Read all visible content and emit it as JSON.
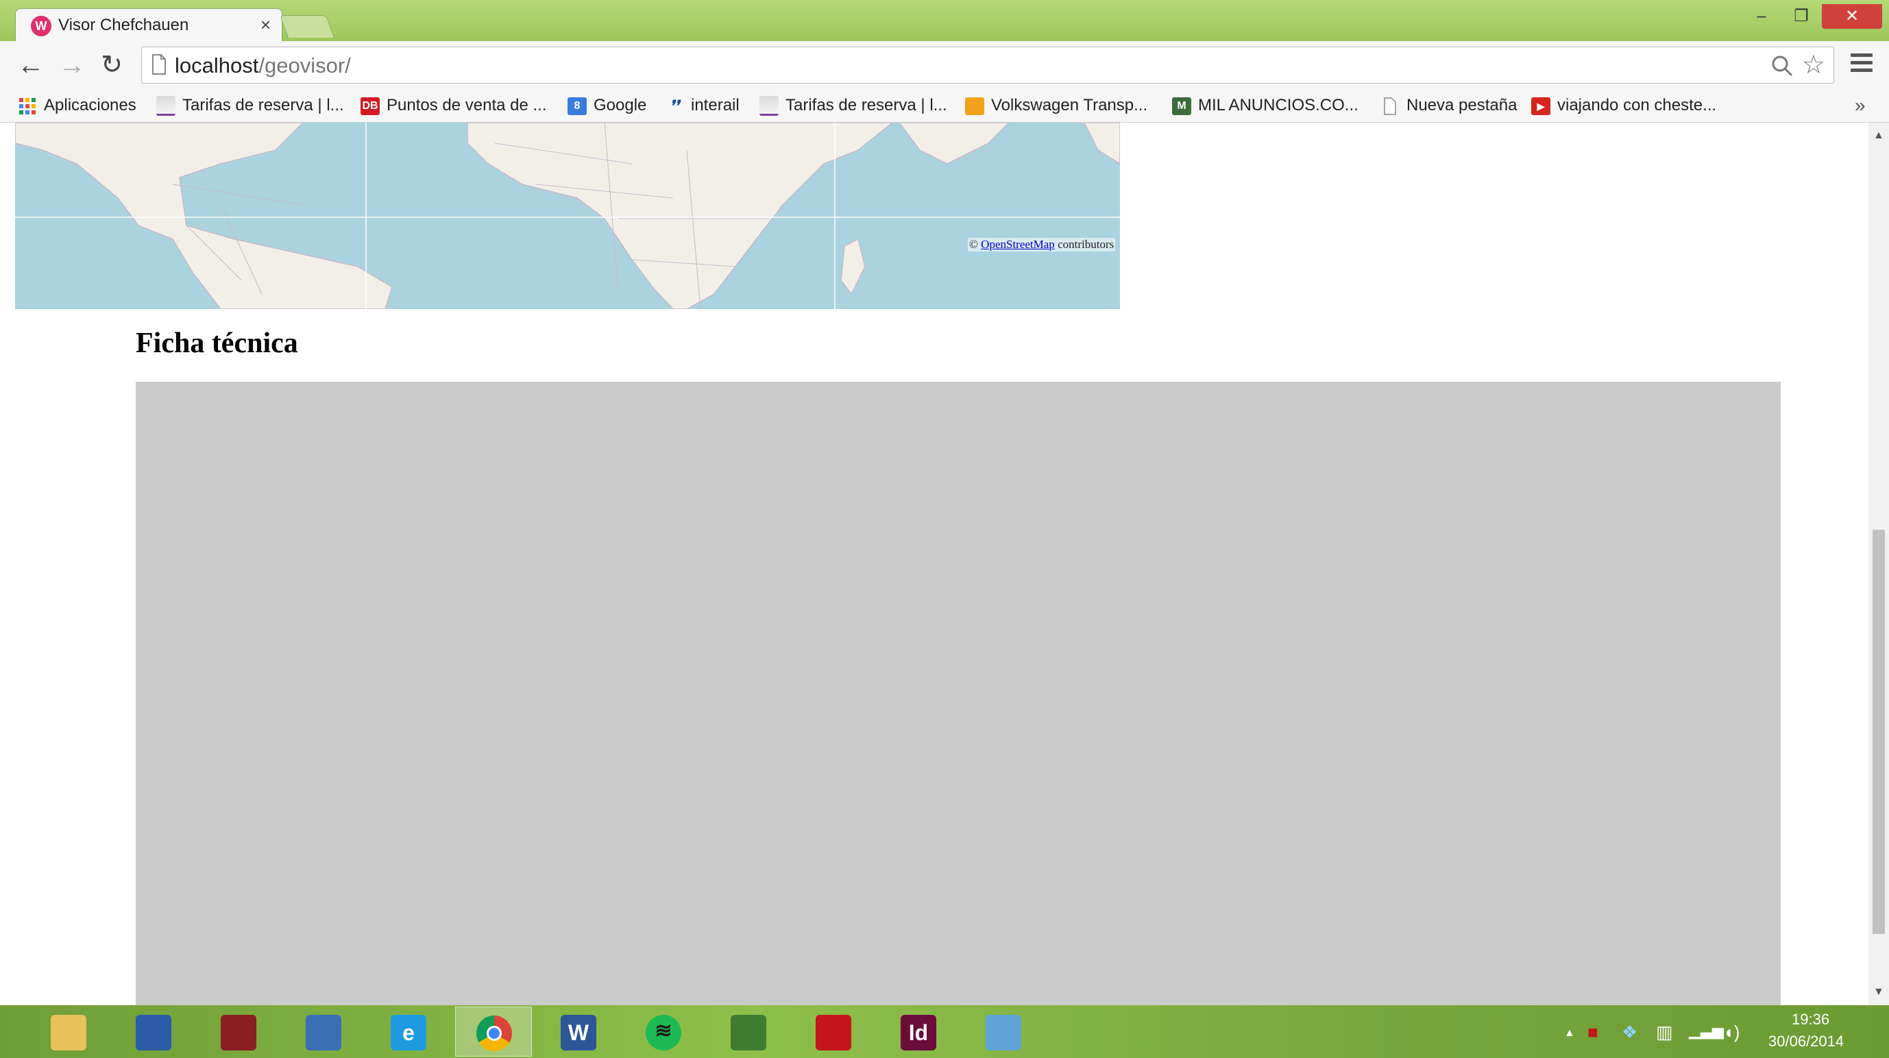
{
  "browser": {
    "tab": {
      "title": "Visor Chefchauen",
      "close": "×",
      "favicon": "W"
    },
    "window_controls": {
      "minimize": "–",
      "maximize": "❐",
      "close": "✕"
    },
    "nav": {
      "back": "←",
      "forward": "→",
      "reload": "↻"
    },
    "address": {
      "host": "localhost",
      "path": "/geovisor/"
    },
    "bookmarks": [
      {
        "label": "Aplicaciones",
        "icon": "apps-grid-icon"
      },
      {
        "label": "Tarifas de reserva | l...",
        "icon": "renfe-icon"
      },
      {
        "label": "Puntos de venta de ...",
        "icon": "db-icon",
        "badge": "DB"
      },
      {
        "label": "Google",
        "icon": "google-icon",
        "badge": "8"
      },
      {
        "label": "interail",
        "icon": "interrail-icon"
      },
      {
        "label": "Tarifas de reserva | l...",
        "icon": "renfe-icon"
      },
      {
        "label": "Volkswagen Transp...",
        "icon": "box-icon"
      },
      {
        "label": "MIL ANUNCIOS.CO...",
        "icon": "milanuncios-icon"
      },
      {
        "label": "Nueva pestaña",
        "icon": "page-icon"
      },
      {
        "label": "viajando con cheste...",
        "icon": "youtube-icon"
      }
    ],
    "bookmarks_overflow": "»"
  },
  "page": {
    "map": {
      "attribution_prefix": "© ",
      "attribution_link": "OpenStreetMap",
      "attribution_suffix": " contributors"
    },
    "heading": "Ficha técnica"
  },
  "taskbar": {
    "apps": [
      {
        "name": "file-explorer",
        "icon": "folder-icon",
        "glyph": "",
        "color": "#e8c15a"
      },
      {
        "name": "remote-desktop",
        "icon": "monitor-icon",
        "glyph": "",
        "color": "#2c5ca8"
      },
      {
        "name": "media-player",
        "icon": "media-icon",
        "glyph": "",
        "color": "#8b1d24"
      },
      {
        "name": "messenger",
        "icon": "chat-icon",
        "glyph": "",
        "color": "#3a6fb5"
      },
      {
        "name": "internet-explorer",
        "icon": "ie-icon",
        "glyph": "e",
        "color": "#1e9be0"
      },
      {
        "name": "chrome",
        "icon": "chrome-icon",
        "glyph": "",
        "color": "#db4437",
        "active": true
      },
      {
        "name": "word",
        "icon": "word-icon",
        "glyph": "W",
        "color": "#2b5797"
      },
      {
        "name": "spotify",
        "icon": "spotify-icon",
        "glyph": "",
        "color": "#1a1a1a"
      },
      {
        "name": "project",
        "icon": "chart-pen-icon",
        "glyph": "",
        "color": "#3e7d2f"
      },
      {
        "name": "acrobat",
        "icon": "acrobat-icon",
        "glyph": "",
        "color": "#c4161c"
      },
      {
        "name": "indesign",
        "icon": "indesign-icon",
        "glyph": "Id",
        "color": "#6b0c3a"
      },
      {
        "name": "paint",
        "icon": "palette-icon",
        "glyph": "",
        "color": "#5fa4d6"
      }
    ],
    "tray": {
      "expand": "▲"
    },
    "clock": {
      "time": "19:36",
      "date": "30/06/2014"
    }
  }
}
